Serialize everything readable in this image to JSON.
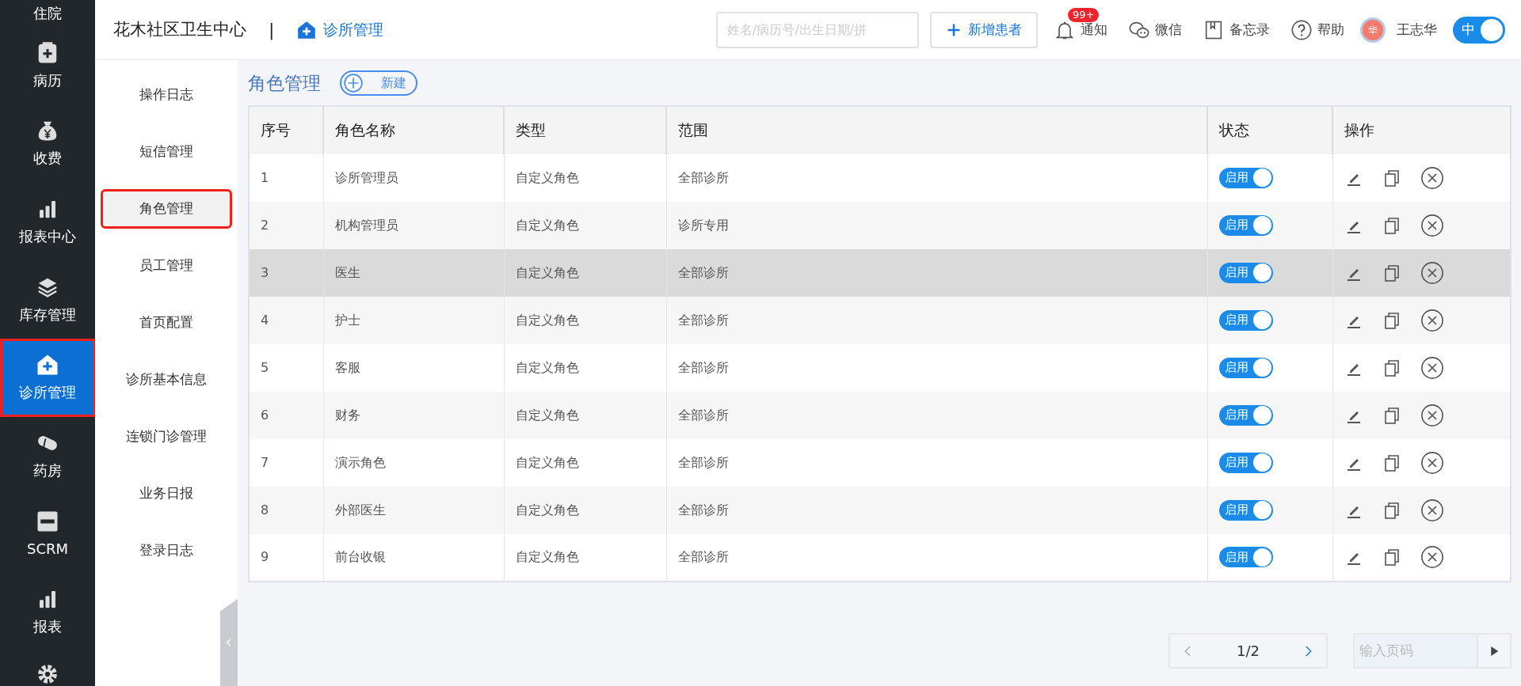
{
  "nav": [
    {
      "label": "住院",
      "selected": false
    },
    {
      "label": "病历",
      "selected": false
    },
    {
      "label": "收费",
      "selected": false
    },
    {
      "label": "报表中心",
      "selected": false
    },
    {
      "label": "库存管理",
      "selected": false
    },
    {
      "label": "诊所管理",
      "selected": true
    },
    {
      "label": "药房",
      "selected": false
    },
    {
      "label": "SCRM",
      "selected": false
    },
    {
      "label": "报表",
      "selected": false
    }
  ],
  "header": {
    "org": "花木社区卫生中心",
    "separator": "|",
    "module": "诊所管理",
    "search": {
      "placeholder": "姓名/病历号/出生日期/拼"
    },
    "new_patient": "新增患者",
    "notify": {
      "label": "通知",
      "badge": "99+"
    },
    "wechat": "微信",
    "memo": "备忘录",
    "help": "帮助",
    "user": {
      "avatar": "华",
      "name": "王志华"
    },
    "lang": {
      "label": "中",
      "on": true
    }
  },
  "submenu": [
    {
      "label": "操作日志",
      "selected": false
    },
    {
      "label": "短信管理",
      "selected": false
    },
    {
      "label": "角色管理",
      "selected": true
    },
    {
      "label": "员工管理",
      "selected": false
    },
    {
      "label": "首页配置",
      "selected": false
    },
    {
      "label": "诊所基本信息",
      "selected": false
    },
    {
      "label": "连锁门诊管理",
      "selected": false
    },
    {
      "label": "业务日报",
      "selected": false
    },
    {
      "label": "登录日志",
      "selected": false
    }
  ],
  "page": {
    "title": "角色管理",
    "new_button": "新建"
  },
  "table": {
    "columns": [
      "序号",
      "角色名称",
      "类型",
      "范围",
      "状态",
      "操作"
    ],
    "rows": [
      {
        "no": "1",
        "name": "诊所管理员",
        "type": "自定义角色",
        "scope": "全部诊所",
        "status": "启用",
        "on": true,
        "selected": false
      },
      {
        "no": "2",
        "name": "机构管理员",
        "type": "自定义角色",
        "scope": "诊所专用",
        "status": "启用",
        "on": true,
        "selected": false
      },
      {
        "no": "3",
        "name": "医生",
        "type": "自定义角色",
        "scope": "全部诊所",
        "status": "启用",
        "on": true,
        "selected": true
      },
      {
        "no": "4",
        "name": "护士",
        "type": "自定义角色",
        "scope": "全部诊所",
        "status": "启用",
        "on": true,
        "selected": false
      },
      {
        "no": "5",
        "name": "客服",
        "type": "自定义角色",
        "scope": "全部诊所",
        "status": "启用",
        "on": true,
        "selected": false
      },
      {
        "no": "6",
        "name": "财务",
        "type": "自定义角色",
        "scope": "全部诊所",
        "status": "启用",
        "on": true,
        "selected": false
      },
      {
        "no": "7",
        "name": "演示角色",
        "type": "自定义角色",
        "scope": "全部诊所",
        "status": "启用",
        "on": true,
        "selected": false
      },
      {
        "no": "8",
        "name": "外部医生",
        "type": "自定义角色",
        "scope": "全部诊所",
        "status": "启用",
        "on": true,
        "selected": false
      },
      {
        "no": "9",
        "name": "前台收银",
        "type": "自定义角色",
        "scope": "全部诊所",
        "status": "启用",
        "on": true,
        "selected": false
      }
    ]
  },
  "pagination": {
    "page": "1/2",
    "input_placeholder": "输入页码"
  }
}
